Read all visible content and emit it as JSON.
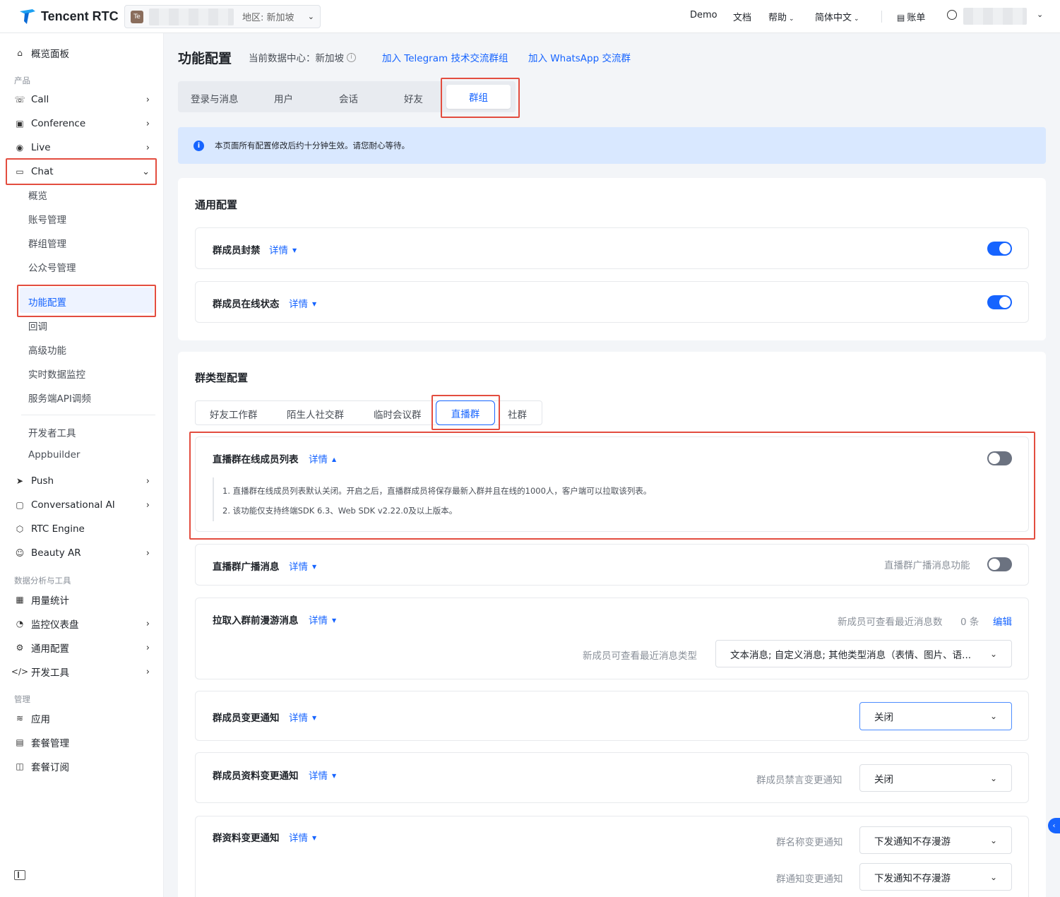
{
  "topbar": {
    "logo_text": "Tencent RTC",
    "project_badge": "Te",
    "region": "地区: 新加坡",
    "nav": {
      "demo": "Demo",
      "docs": "文档",
      "help": "帮助",
      "lang": "简体中文",
      "billing": "账单"
    }
  },
  "sidebar": {
    "overview": "概览面板",
    "group_products": "产品",
    "products": [
      "Call",
      "Conference",
      "Live",
      "Chat"
    ],
    "chat_sub": [
      "概览",
      "账号管理",
      "群组管理",
      "公众号管理",
      "功能配置",
      "回调",
      "高级功能",
      "实时数据监控",
      "服务端API调频"
    ],
    "chat_sub2": [
      "开发者工具",
      "Appbuilder"
    ],
    "products2": [
      "Push",
      "Conversational AI",
      "RTC Engine",
      "Beauty AR"
    ],
    "group_data": "数据分析与工具",
    "data_tools": [
      "用量统计",
      "监控仪表盘",
      "通用配置",
      "开发工具"
    ],
    "group_manage": "管理",
    "manage": [
      "应用",
      "套餐管理",
      "套餐订阅"
    ]
  },
  "header": {
    "title": "功能配置",
    "datacenter": "当前数据中心：新加坡",
    "link_telegram": "加入 Telegram 技术交流群组",
    "link_whatsapp": "加入 WhatsApp 交流群"
  },
  "main_tabs": [
    "登录与消息",
    "用户",
    "会话",
    "好友",
    "群组"
  ],
  "notice": "本页面所有配置修改后约十分钟生效。请您耐心等待。",
  "detail_label": "详情",
  "general": {
    "title": "通用配置",
    "rows": [
      {
        "label": "群成员封禁",
        "enabled": true
      },
      {
        "label": "群成员在线状态",
        "enabled": true
      }
    ]
  },
  "group_types": {
    "title": "群类型配置",
    "tabs": [
      "好友工作群",
      "陌生人社交群",
      "临时会议群",
      "直播群",
      "社群"
    ],
    "active_tab": "直播群",
    "online_list": {
      "label": "直播群在线成员列表",
      "enabled": false,
      "desc": [
        "1. 直播群在线成员列表默认关闭。开启之后，直播群成员将保存最新入群并且在线的1000人，客户端可以拉取该列表。",
        "2. 该功能仅支持终端SDK 6.3、Web SDK v2.22.0及以上版本。"
      ]
    },
    "broadcast": {
      "label": "直播群广播消息",
      "right_label": "直播群广播消息功能",
      "enabled": false
    },
    "roaming": {
      "label": "拉取入群前漫游消息",
      "count_label": "新成员可查看最近消息数",
      "count_value": "0 条",
      "edit": "编辑",
      "type_label": "新成员可查看最近消息类型",
      "type_value": "文本消息; 自定义消息; 其他类型消息（表情、图片、语..."
    },
    "member_change": {
      "label": "群成员变更通知",
      "value": "关闭"
    },
    "member_profile": {
      "label": "群成员资料变更通知",
      "right_label": "群成员禁言变更通知",
      "value": "关闭"
    },
    "group_profile": {
      "label": "群资料变更通知",
      "name_label": "群名称变更通知",
      "name_value": "下发通知不存漫游",
      "notice_label": "群通知变更通知",
      "notice_value": "下发通知不存漫游"
    }
  },
  "colors": {
    "accent": "#1664ff",
    "highlight": "#e34d3f",
    "notice_bg": "#d9e8ff"
  }
}
